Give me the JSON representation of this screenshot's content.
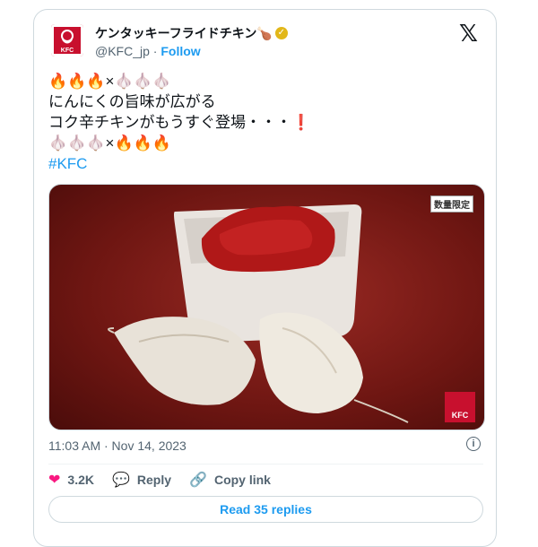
{
  "header": {
    "display_name": "ケンタッキーフライドチキン🍗",
    "handle": "@KFC_jp",
    "separator": " · ",
    "follow_label": "Follow"
  },
  "tweet": {
    "line1_fire": "🔥🔥🔥",
    "line1_x": "×",
    "line1_garlic": "🧄🧄🧄",
    "line2": "にんにくの旨味が広がる",
    "line3": "コク辛チキンがもうすぐ登場・・・",
    "line3_exclaim": "❗",
    "line4_garlic": "🧄🧄🧄",
    "line4_x": "×",
    "line4_fire": "🔥🔥🔥",
    "hashtag": "#KFC"
  },
  "media": {
    "badge": "数量限定",
    "logo_text": "KFC"
  },
  "meta": {
    "timestamp": "11:03 AM · Nov 14, 2023"
  },
  "actions": {
    "likes": "3.2K",
    "reply_label": "Reply",
    "copy_link_label": "Copy link",
    "read_replies": "Read 35 replies"
  }
}
